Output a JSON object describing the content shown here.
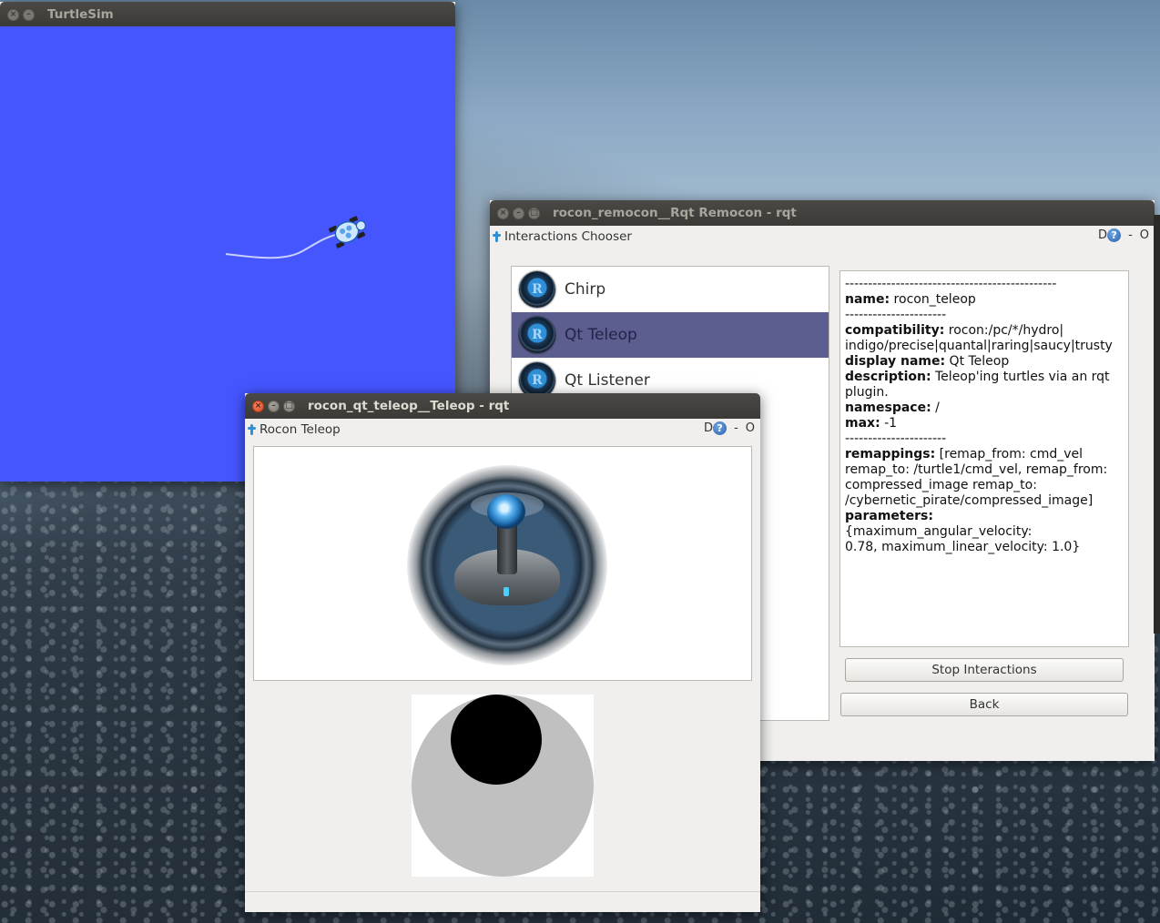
{
  "turtlesim": {
    "title": "TurtleSim",
    "bg_color": "#4556ff"
  },
  "remocon": {
    "title": "rocon_remocon__Rqt Remocon - rqt",
    "plugin_name": "Interactions Chooser",
    "d_label": "D",
    "help_label": "?",
    "dash_label": "-",
    "o_label": "O",
    "items": [
      {
        "label": "Chirp",
        "selected": false
      },
      {
        "label": "Qt Teleop",
        "selected": true
      },
      {
        "label": "Qt Listener",
        "selected": false
      }
    ],
    "info": {
      "sep_long": "----------------------------------------------",
      "sep_short": "----------------------",
      "name_key": "name:",
      "name_val": " rocon_teleop",
      "compat_key": "compatibility:",
      "compat_val1": " rocon:/pc/*/hydro|",
      "compat_val2": "indigo/precise|quantal|raring|saucy|trusty",
      "display_key": "display name:",
      "display_val": " Qt Teleop",
      "desc_key": "description:",
      "desc_val1": " Teleop'ing turtles via an rqt",
      "desc_val2": "plugin.",
      "ns_key": "namespace:",
      "ns_val": " /",
      "max_key": "max:",
      "max_val": " -1",
      "remap_key": "remappings:",
      "remap_val1": " [remap_from: cmd_vel",
      "remap_val2": "remap_to: /turtle1/cmd_vel, remap_from:",
      "remap_val3": "compressed_image remap_to:",
      "remap_val4": "/cybernetic_pirate/compressed_image]",
      "params_key": "parameters:",
      "params_val1": " {maximum_angular_velocity:",
      "params_val2": "0.78, maximum_linear_velocity: 1.0}"
    },
    "stop_label": "Stop Interactions",
    "back_label": "Back"
  },
  "teleop": {
    "title": "rocon_qt_teleop__Teleop - rqt",
    "plugin_name": "Rocon Teleop",
    "d_label": "D",
    "help_label": "?",
    "dash_label": "-",
    "o_label": "O",
    "joystick": {
      "x": 0,
      "y": 1
    }
  },
  "colors": {
    "selection": "#5b5e8e",
    "close_button": "#e0562b",
    "pad_ring": "#c0c0c0",
    "pad_knob": "#000000"
  }
}
